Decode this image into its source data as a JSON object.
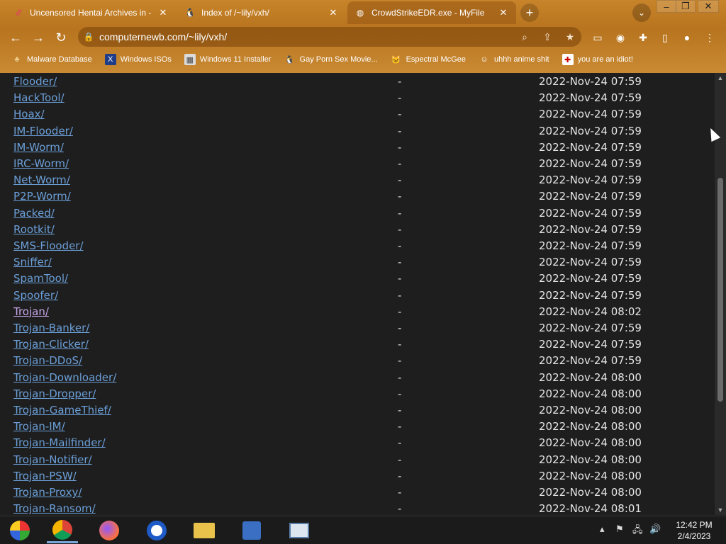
{
  "tabs": [
    {
      "title": "Uncensored Hentai Archives in -",
      "favicon": "site-icon",
      "active": false
    },
    {
      "title": "Index of /~lily/vxh/",
      "favicon": "penguin-icon",
      "active": false
    },
    {
      "title": "CrowdStrikeEDR.exe - MyFile",
      "favicon": "globe-icon",
      "active": true
    }
  ],
  "toolbar": {
    "url": "computernewb.com/~lily/vxh/"
  },
  "bookmarks": [
    {
      "label": "Malware Database",
      "icon": "mushroom-icon"
    },
    {
      "label": "Windows ISOs",
      "icon": "x-logo-icon"
    },
    {
      "label": "Windows 11 Installer",
      "icon": "image-icon"
    },
    {
      "label": "Gay Porn Sex Movie...",
      "icon": "penguin-icon"
    },
    {
      "label": "Espectral McGee",
      "icon": "cat-icon"
    },
    {
      "label": "uhhh anime shit",
      "icon": "anime-icon"
    },
    {
      "label": "you are an idiot!",
      "icon": "flag-icon"
    }
  ],
  "listing": [
    {
      "name": "Flooder/",
      "size": "-",
      "date": "2022-Nov-24 07:59"
    },
    {
      "name": "HackTool/",
      "size": "-",
      "date": "2022-Nov-24 07:59"
    },
    {
      "name": "Hoax/",
      "size": "-",
      "date": "2022-Nov-24 07:59"
    },
    {
      "name": "IM-Flooder/",
      "size": "-",
      "date": "2022-Nov-24 07:59"
    },
    {
      "name": "IM-Worm/",
      "size": "-",
      "date": "2022-Nov-24 07:59"
    },
    {
      "name": "IRC-Worm/",
      "size": "-",
      "date": "2022-Nov-24 07:59"
    },
    {
      "name": "Net-Worm/",
      "size": "-",
      "date": "2022-Nov-24 07:59"
    },
    {
      "name": "P2P-Worm/",
      "size": "-",
      "date": "2022-Nov-24 07:59"
    },
    {
      "name": "Packed/",
      "size": "-",
      "date": "2022-Nov-24 07:59"
    },
    {
      "name": "Rootkit/",
      "size": "-",
      "date": "2022-Nov-24 07:59"
    },
    {
      "name": "SMS-Flooder/",
      "size": "-",
      "date": "2022-Nov-24 07:59"
    },
    {
      "name": "Sniffer/",
      "size": "-",
      "date": "2022-Nov-24 07:59"
    },
    {
      "name": "SpamTool/",
      "size": "-",
      "date": "2022-Nov-24 07:59"
    },
    {
      "name": "Spoofer/",
      "size": "-",
      "date": "2022-Nov-24 07:59"
    },
    {
      "name": "Trojan/",
      "size": "-",
      "date": "2022-Nov-24 08:02",
      "visited": true
    },
    {
      "name": "Trojan-Banker/",
      "size": "-",
      "date": "2022-Nov-24 07:59"
    },
    {
      "name": "Trojan-Clicker/",
      "size": "-",
      "date": "2022-Nov-24 07:59"
    },
    {
      "name": "Trojan-DDoS/",
      "size": "-",
      "date": "2022-Nov-24 07:59"
    },
    {
      "name": "Trojan-Downloader/",
      "size": "-",
      "date": "2022-Nov-24 08:00"
    },
    {
      "name": "Trojan-Dropper/",
      "size": "-",
      "date": "2022-Nov-24 08:00"
    },
    {
      "name": "Trojan-GameThief/",
      "size": "-",
      "date": "2022-Nov-24 08:00"
    },
    {
      "name": "Trojan-IM/",
      "size": "-",
      "date": "2022-Nov-24 08:00"
    },
    {
      "name": "Trojan-Mailfinder/",
      "size": "-",
      "date": "2022-Nov-24 08:00"
    },
    {
      "name": "Trojan-Notifier/",
      "size": "-",
      "date": "2022-Nov-24 08:00"
    },
    {
      "name": "Trojan-PSW/",
      "size": "-",
      "date": "2022-Nov-24 08:00"
    },
    {
      "name": "Trojan-Proxy/",
      "size": "-",
      "date": "2022-Nov-24 08:00"
    },
    {
      "name": "Trojan-Ransom/",
      "size": "-",
      "date": "2022-Nov-24 08:01"
    }
  ],
  "taskbar": {
    "apps": [
      "windows-logo-icon",
      "chrome-icon",
      "firefox-icon",
      "opera-icon",
      "file-explorer-icon",
      "installer-icon",
      "window-app-icon"
    ],
    "time": "12:42 PM",
    "date": "2/4/2023"
  },
  "colors": {
    "link": "#6b9fd8",
    "visited_link": "#c7a6e8",
    "page_bg": "#1e1e1e",
    "theme": "#c8842a"
  }
}
